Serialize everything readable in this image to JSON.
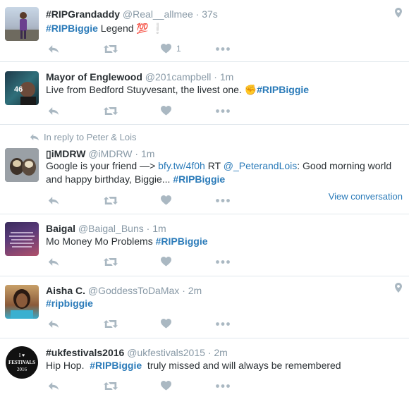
{
  "colors": {
    "link": "#2b7bb9",
    "meta": "#8899a6",
    "text": "#292f33",
    "icon": "#aab8c2",
    "divider": "#e1e8ed"
  },
  "tweets": [
    {
      "name": "#RIPGrandaddy",
      "handle": "@Real__allmee",
      "time": "37s",
      "text_parts": [
        "#RIPBiggie",
        " Legend ",
        "💯",
        " ❕"
      ],
      "like_count": "1"
    },
    {
      "name": "Mayor of Englewood",
      "handle": "@201campbell",
      "time": "1m",
      "avatar_text": "46",
      "text_parts": [
        "Live from Bedford Stuyvesant, the livest one. ",
        "✊",
        "#RIPBiggie"
      ]
    },
    {
      "context": "In reply to Peter & Lois",
      "name": "iMDRW",
      "handle": "@iMDRW",
      "time": "1m",
      "text_parts": [
        "Google is your friend —> ",
        "bfy.tw/4f0h",
        " RT ",
        "@_PeterandLois",
        ": Good morning world",
        "and happy birthday, Biggie... ",
        "#RIPBiggie"
      ],
      "view_conversation": "View conversation"
    },
    {
      "name": "Baigal",
      "handle": "@Baigal_Buns",
      "time": "1m",
      "text_parts": [
        "Mo Money Mo Problems ",
        "#RIPBiggie"
      ]
    },
    {
      "name": "Aisha C.",
      "handle": "@GoddessToDaMax",
      "time": "2m",
      "text_parts": [
        "#ripbiggie"
      ]
    },
    {
      "name": "#ukfestivals2016",
      "handle": "@ukfestivals2015",
      "time": "2m",
      "avatar_text": [
        "I ♥",
        "FESTIVALS",
        "2016"
      ],
      "text_parts": [
        "Hip Hop.  ",
        "#RIPBiggie",
        "  truly missed and will always be remembered"
      ]
    }
  ],
  "icons": {
    "reply": "reply-icon",
    "retweet": "retweet-icon",
    "like": "heart-icon",
    "more": "more-icon",
    "location": "location-pin-icon",
    "reply_context": "reply-context-icon"
  }
}
